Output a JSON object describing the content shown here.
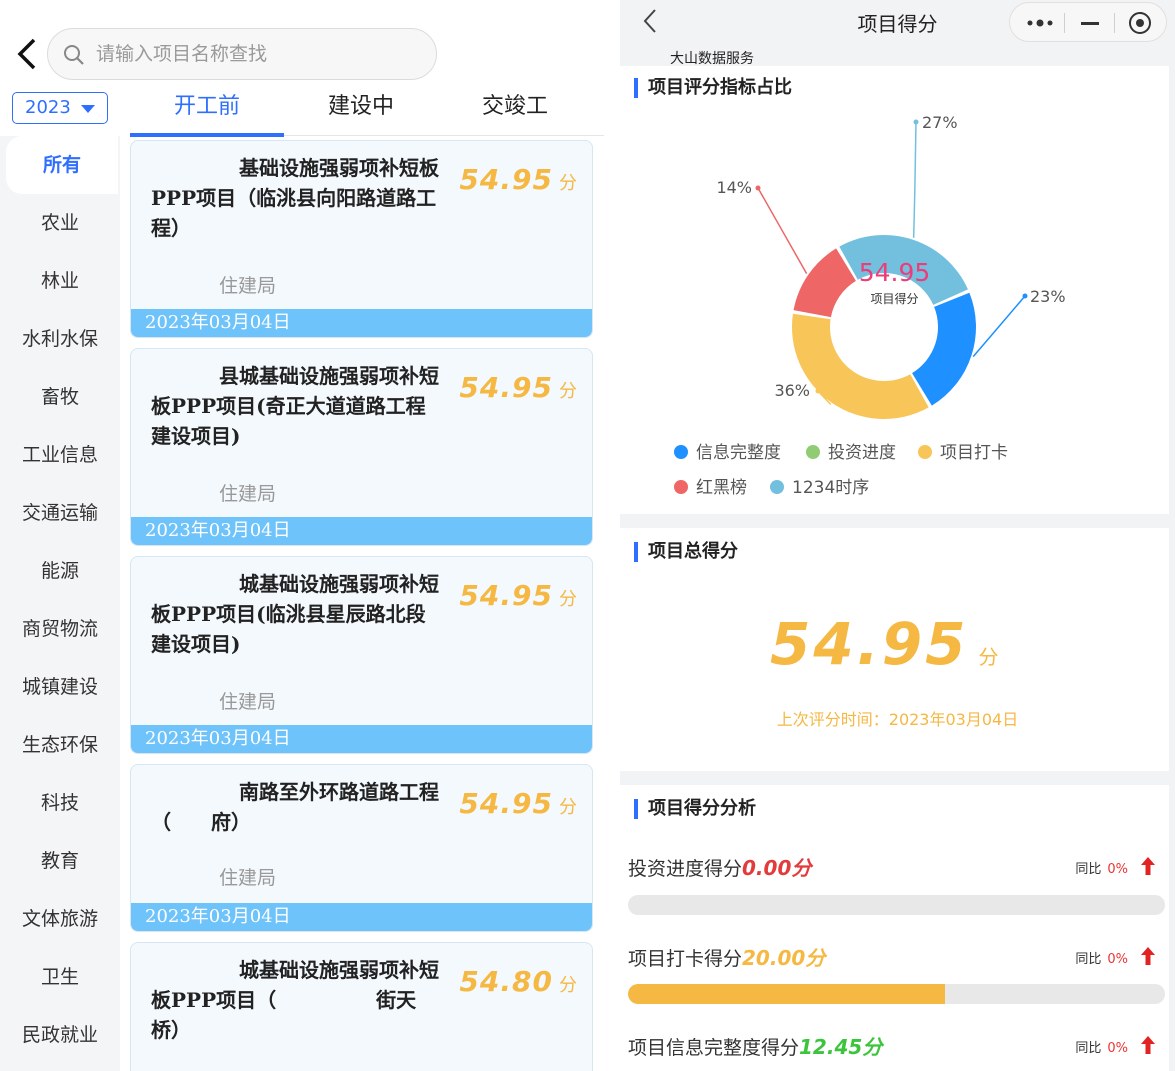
{
  "left": {
    "search_placeholder": "请输入项目名称查找",
    "year": "2023",
    "tabs": [
      "开工前",
      "建设中",
      "交竣工"
    ],
    "sidebar": [
      "所有",
      "农业",
      "林业",
      "水利水保",
      "畜牧",
      "工业信息",
      "交通运输",
      "能源",
      "商贸物流",
      "城镇建设",
      "生态环保",
      "科技",
      "教育",
      "文体旅游",
      "卫生",
      "民政就业"
    ],
    "cards": [
      {
        "title": "基础设施强弱项补短板PPP项目（临洮县向阳路道路工程）",
        "score": "54.95",
        "unit": "分",
        "dept": "住建局",
        "date": "2023年03月04日"
      },
      {
        "title": "县城基础设施强弱项补短板PPP项目(奇正大道道路工程建设项目)",
        "score": "54.95",
        "unit": "分",
        "dept": "住建局",
        "date": "2023年03月04日"
      },
      {
        "title": "城基础设施强弱项补短板PPP项目(临洮县星辰路北段建设项目)",
        "score": "54.95",
        "unit": "分",
        "dept": "住建局",
        "date": "2023年03月04日"
      },
      {
        "title": "南路至外环路道路工程（　　府）",
        "score": "54.95",
        "unit": "分",
        "dept": "住建局",
        "date": "2023年03月04日"
      },
      {
        "title": "城基础设施强弱项补短板PPP项目（　　　　　街天桥）",
        "score": "54.80",
        "unit": "分",
        "dept": "",
        "date": ""
      }
    ]
  },
  "right": {
    "title": "项目得分",
    "subtitle": "大山数据服务",
    "sections": {
      "ratio": "项目评分指标占比",
      "total": "项目总得分",
      "analysis": "项目得分分析"
    },
    "donut_center_value": "54.95",
    "donut_center_label": "项目得分",
    "total_score": "54.95",
    "total_unit": "分",
    "last_time": "上次评分时间：2023年03月04日",
    "analysis": [
      {
        "label": "投资进度得分",
        "value": "0.00分",
        "color": "#e33b3b",
        "yoy_label": "同比",
        "yoy": "0%",
        "progress": 0
      },
      {
        "label": "项目打卡得分",
        "value": "20.00分",
        "color": "#f5b843",
        "yoy_label": "同比",
        "yoy": "0%",
        "progress": 0.59
      },
      {
        "label": "项目信息完整度得分",
        "value": "12.45分",
        "color": "#3cc43c",
        "yoy_label": "同比",
        "yoy": "0%",
        "progress": null
      }
    ]
  },
  "chart_data": {
    "type": "pie",
    "title": "",
    "slices": [
      {
        "name": "信息完整度",
        "value": 23,
        "label": "23%",
        "color": "#1e90ff"
      },
      {
        "name": "项目打卡",
        "value": 36,
        "label": "36%",
        "color": "#f8c558"
      },
      {
        "name": "红黑榜",
        "value": 14,
        "label": "14%",
        "color": "#ee6666"
      },
      {
        "name": "1234时序",
        "value": 27,
        "label": "27%",
        "color": "#73c0de"
      }
    ],
    "legend": [
      {
        "name": "信息完整度",
        "color": "#1e90ff"
      },
      {
        "name": "投资进度",
        "color": "#91cc75"
      },
      {
        "name": "项目打卡",
        "color": "#f8c558"
      },
      {
        "name": "红黑榜",
        "color": "#ee6666"
      },
      {
        "name": "1234时序",
        "color": "#73c0de"
      }
    ],
    "legend_placement": "bottom"
  }
}
